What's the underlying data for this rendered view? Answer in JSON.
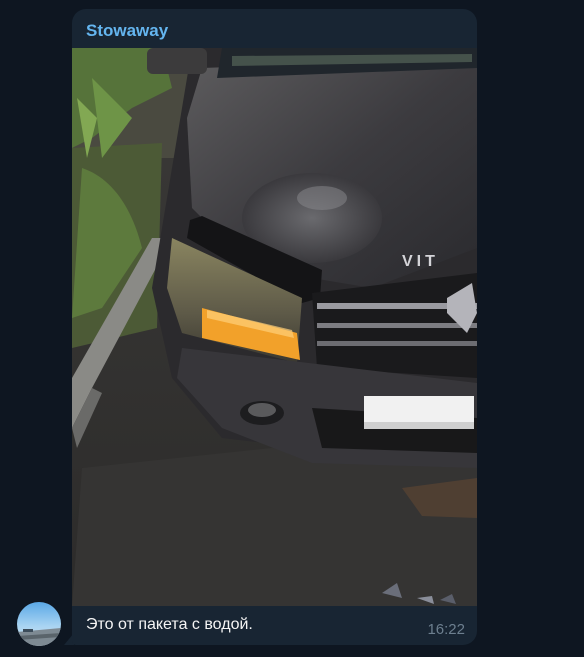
{
  "message": {
    "sender": "Stowaway",
    "caption": "Это от пакета с водой.",
    "time": "16:22",
    "photo_description_icon": "car-photo",
    "plate_text": "",
    "car_badge": "VIT"
  },
  "colors": {
    "background": "#0e1621",
    "bubble": "#182533",
    "sender_name": "#64b5ef",
    "caption": "#f5f5f5",
    "time": "#6d7f8f"
  }
}
